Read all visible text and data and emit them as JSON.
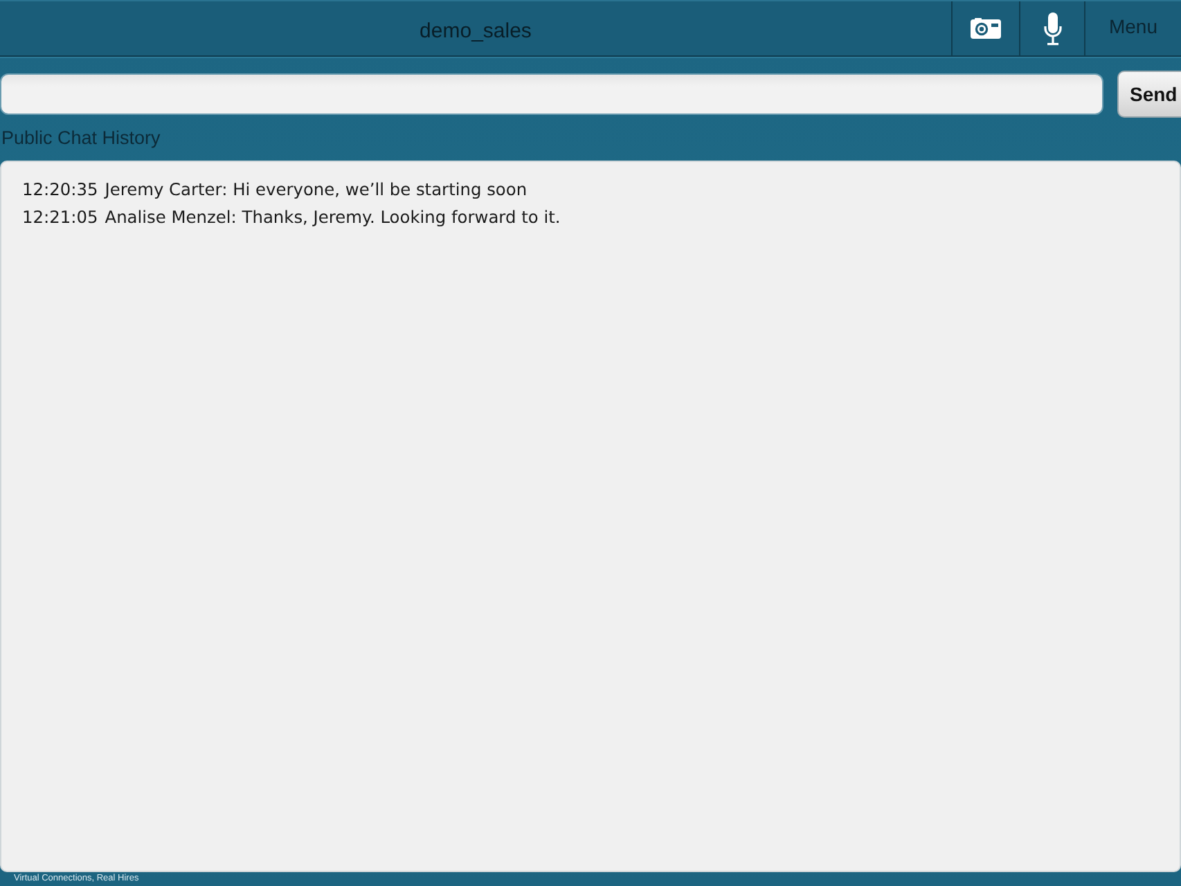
{
  "header": {
    "title": "demo_sales",
    "menu_label": "Menu"
  },
  "composer": {
    "send_label": "Send"
  },
  "chat_history": {
    "title": "Public Chat History",
    "messages": [
      {
        "time": "12:20:35",
        "text": "Jeremy Carter: Hi everyone, we’ll be starting soon"
      },
      {
        "time": "12:21:05",
        "text": "Analise Menzel: Thanks, Jeremy. Looking forward to it."
      }
    ]
  },
  "footer": {
    "tagline": "Virtual Connections, Real Hires"
  }
}
